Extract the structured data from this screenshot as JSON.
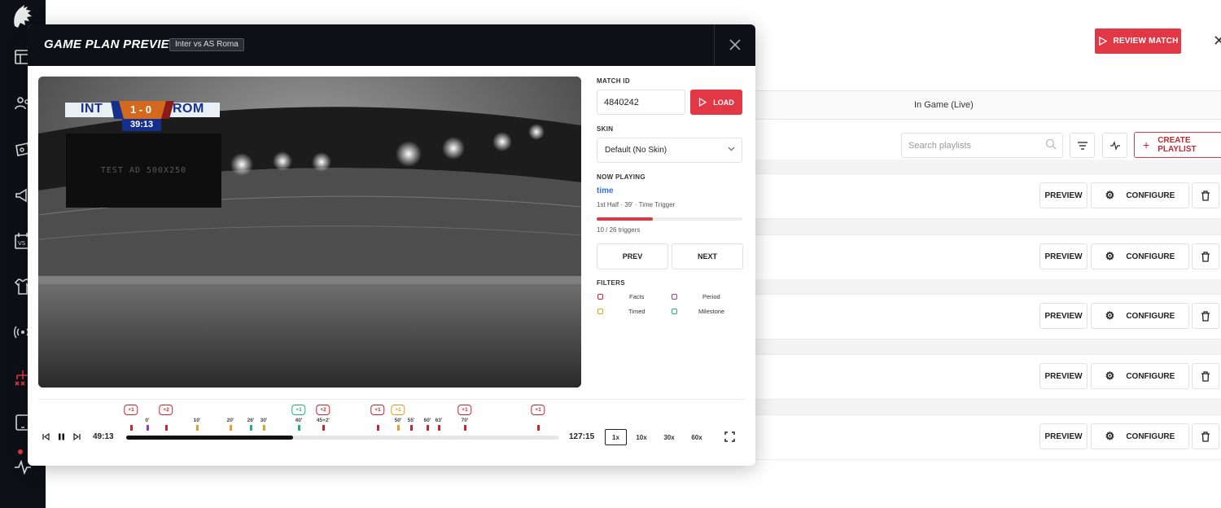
{
  "background": {
    "review_label": "REVIEW MATCH",
    "tab_live": "In Game (Live)",
    "search_placeholder": "Search playlists",
    "create_label": "CREATE PLAYLIST",
    "row_actions": {
      "preview": "PREVIEW",
      "configure": "CONFIGURE"
    }
  },
  "modal": {
    "title": "GAME PLAN PREVIEW",
    "match_tag": "Inter vs AS Roma",
    "scoreboard": {
      "home": "INT",
      "away": "ROM",
      "score": "1 - 0",
      "clock": "39:13"
    },
    "ad_text": "TEST AD 500X250",
    "match_id": {
      "label": "MATCH ID",
      "value": "4840242",
      "load": "LOAD"
    },
    "skin": {
      "label": "SKIN",
      "value": "Default (No Skin)"
    },
    "now_playing": {
      "label": "NOW PLAYING",
      "title": "time",
      "subtitle": "1st Half · 39' · Time Trigger",
      "progress": 0.385,
      "triggers": "10 / 26 triggers"
    },
    "prev": "PREV",
    "next": "NEXT",
    "filters": {
      "label": "FILTERS",
      "items": [
        {
          "name": "Facts",
          "color": "#c42633"
        },
        {
          "name": "Period",
          "color": "#8b3fc7"
        },
        {
          "name": "Timed",
          "color": "#e0a020"
        },
        {
          "name": "Milestone",
          "color": "#1fb37a"
        }
      ]
    },
    "timeline": {
      "current": "49:13",
      "total": "127:15",
      "played_fraction": 0.386,
      "speeds": [
        "1x",
        "10x",
        "30x",
        "60x"
      ],
      "active_speed": "1x",
      "markers": [
        {
          "label": "",
          "badge": "+1",
          "color": "#c42633"
        },
        {
          "label": "0'",
          "color": "#8b3fc7"
        },
        {
          "label": "",
          "badge": "+2",
          "color": "#c42633"
        },
        {
          "label": "10'",
          "color": "#e0a020"
        },
        {
          "label": "20'",
          "color": "#e0a020"
        },
        {
          "label": "26'",
          "color": "#1fb37a"
        },
        {
          "label": "30'",
          "color": "#e0a020"
        },
        {
          "label": "40'",
          "badge": "+1",
          "color": "#1fb37a"
        },
        {
          "label": "45+2'",
          "badge": "+2",
          "color": "#c42633"
        },
        {
          "label": "",
          "badge": "+1",
          "color": "#c42633"
        },
        {
          "label": "50'",
          "badge": "+1",
          "color": "#e0a020"
        },
        {
          "label": "55'",
          "color": "#c42633"
        },
        {
          "label": "60'",
          "color": "#c42633"
        },
        {
          "label": "63'",
          "color": "#c42633"
        },
        {
          "label": "70'",
          "badge": "+1",
          "color": "#c42633"
        },
        {
          "label": "",
          "badge": "+1",
          "color": "#c42633"
        }
      ]
    }
  }
}
